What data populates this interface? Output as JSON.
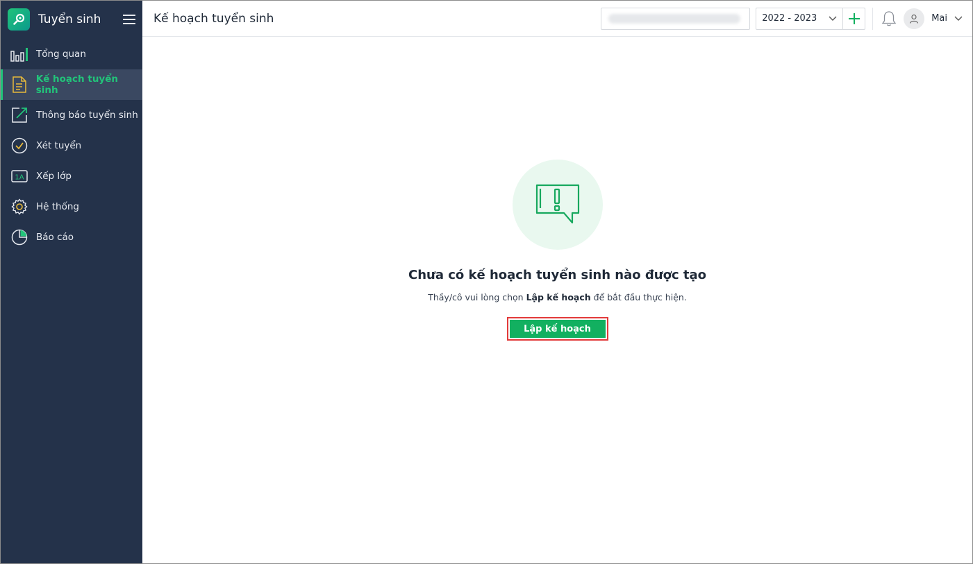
{
  "app": {
    "title": "Tuyển sinh"
  },
  "sidebar": {
    "items": [
      {
        "label": "Tổng quan",
        "icon": "bar-chart-icon"
      },
      {
        "label": "Kế hoạch tuyển sinh",
        "icon": "document-icon",
        "active": true
      },
      {
        "label": "Thông báo tuyển sinh",
        "icon": "arrow-up-right-icon"
      },
      {
        "label": "Xét tuyển",
        "icon": "check-circle-icon"
      },
      {
        "label": "Xếp lớp",
        "icon": "class-1a-icon",
        "icon_text": "1A"
      },
      {
        "label": "Hệ thống",
        "icon": "gear-icon"
      },
      {
        "label": "Báo cáo",
        "icon": "pie-chart-icon"
      }
    ]
  },
  "header": {
    "page_title": "Kế hoạch tuyển sinh",
    "school_year": "2022 - 2023",
    "user_name": "Mai"
  },
  "empty_state": {
    "title": "Chưa có kế hoạch tuyển sinh nào được tạo",
    "desc_prefix": "Thầy/cô vui lòng chọn ",
    "desc_bold": "Lập kế hoạch",
    "desc_suffix": " để bắt đầu thực hiện.",
    "button_label": "Lập kế hoạch"
  },
  "colors": {
    "sidebar_bg": "#24324a",
    "accent": "#22c37a",
    "button_bg": "#12b060",
    "highlight_border": "#e23a3a"
  }
}
